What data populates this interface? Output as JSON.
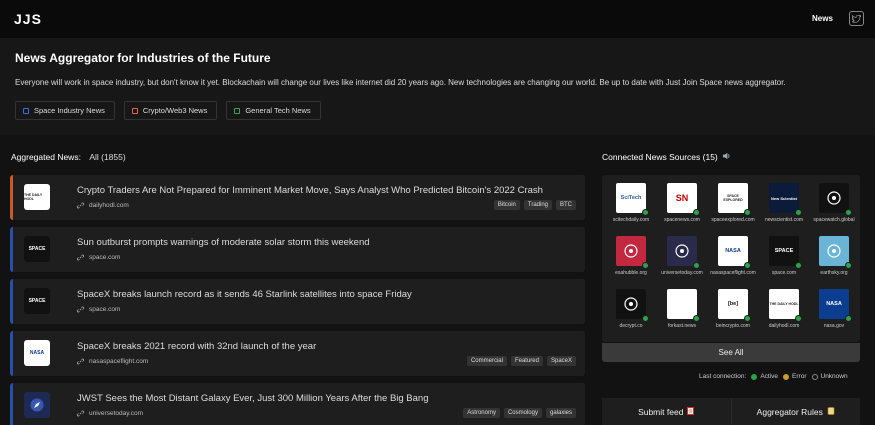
{
  "header": {
    "logo": "JJS",
    "nav_news": "News"
  },
  "hero": {
    "title": "News Aggregator for Industries of the Future",
    "description": "Everyone will work in space industry, but don't know it yet. Blockachain will change our lives like internet did 20 years ago. New technologies are changing our world. Be up to date with Just Join Space news aggregator.",
    "categories": [
      {
        "label": "Space Industry News",
        "color": "#3a6fe0"
      },
      {
        "label": "Crypto/Web3 News",
        "color": "#e06a3a"
      },
      {
        "label": "General Tech News",
        "color": "#3aa35a"
      }
    ]
  },
  "aggregated": {
    "heading": "Aggregated News:",
    "filter": "All (1855)"
  },
  "articles": [
    {
      "title": "Crypto Traders Are Not Prepared for Imminent Market Move, Says Analyst Who Predicted Bitcoin's 2022 Crash",
      "source": "dailyhodl.com",
      "thumb": "THE DAILY HODL",
      "tags": [
        "Bitcoin",
        "Trading",
        "BTC"
      ]
    },
    {
      "title": "Sun outburst prompts warnings of moderate solar storm this weekend",
      "source": "space.com",
      "thumb": "SPACE",
      "tags": []
    },
    {
      "title": "SpaceX breaks launch record as it sends 46 Starlink satellites into space Friday",
      "source": "space.com",
      "thumb": "SPACE",
      "tags": []
    },
    {
      "title": "SpaceX breaks 2021 record with 32nd launch of the year",
      "source": "nasaspaceflight.com",
      "thumb": "NASA",
      "tags": [
        "Commercial",
        "Featured",
        "SpaceX"
      ]
    },
    {
      "title": "JWST Sees the Most Distant Galaxy Ever, Just 300 Million Years After the Big Bang",
      "source": "universetoday.com",
      "thumb": "",
      "tags": [
        "Astronomy",
        "Cosmology",
        "galaxies"
      ]
    }
  ],
  "sources": {
    "heading": "Connected News Sources (15)",
    "items": [
      {
        "name": "scitechdaily.com",
        "glyph": "SciTech"
      },
      {
        "name": "spacenews.com",
        "glyph": "SN"
      },
      {
        "name": "spaceexplored.com",
        "glyph": "SPACE EXPLORED"
      },
      {
        "name": "newscientist.com",
        "glyph": "New Scientist"
      },
      {
        "name": "spacewatch.global",
        "glyph": ""
      },
      {
        "name": "esahubble.org",
        "glyph": ""
      },
      {
        "name": "universetoday.com",
        "glyph": ""
      },
      {
        "name": "nasaspaceflight.com",
        "glyph": "NASA"
      },
      {
        "name": "space.com",
        "glyph": "SPACE"
      },
      {
        "name": "earthsky.org",
        "glyph": ""
      },
      {
        "name": "decrypt.co",
        "glyph": ""
      },
      {
        "name": "forkast.news",
        "glyph": ""
      },
      {
        "name": "beincrypto.com",
        "glyph": "[be]"
      },
      {
        "name": "dailyhodl.com",
        "glyph": "THE DAILY HODL"
      },
      {
        "name": "nasa.gov",
        "glyph": "NASA"
      }
    ],
    "see_all": "See All",
    "last_connection": "Last connection:",
    "legend": [
      "Active",
      "Error",
      "Unknown"
    ]
  },
  "actions": {
    "submit": "Submit feed",
    "rules": "Aggregator Rules"
  }
}
